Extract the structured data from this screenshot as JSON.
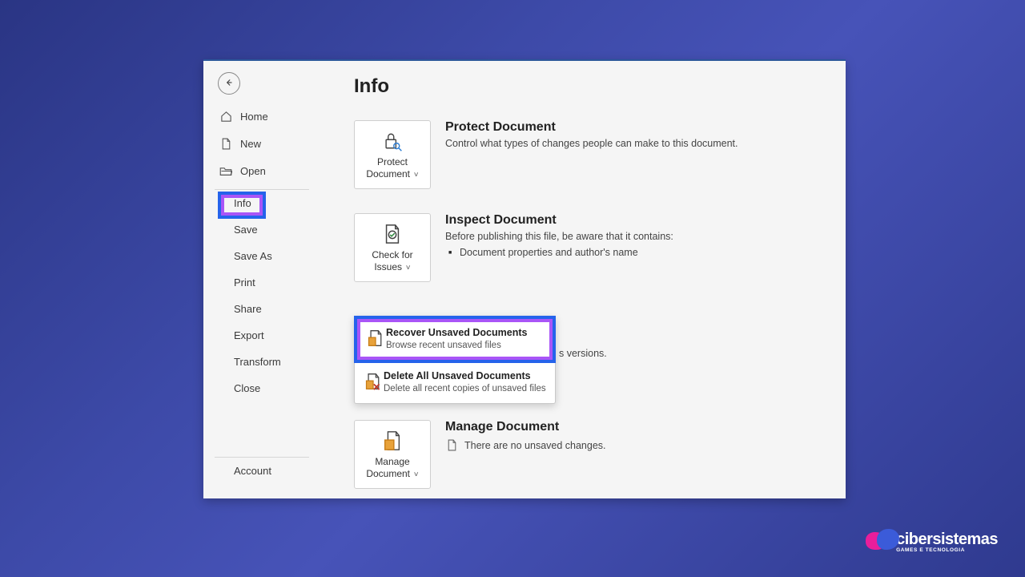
{
  "sidebar": {
    "items": {
      "home": {
        "label": "Home"
      },
      "new": {
        "label": "New"
      },
      "open": {
        "label": "Open"
      },
      "info": {
        "label": "Info"
      },
      "save": {
        "label": "Save"
      },
      "saveas": {
        "label": "Save As"
      },
      "print": {
        "label": "Print"
      },
      "share": {
        "label": "Share"
      },
      "export": {
        "label": "Export"
      },
      "transform": {
        "label": "Transform"
      },
      "close": {
        "label": "Close"
      },
      "account": {
        "label": "Account"
      }
    }
  },
  "page": {
    "title": "Info"
  },
  "sections": {
    "protect": {
      "card_label": "Protect Document",
      "title": "Protect Document",
      "desc": "Control what types of changes people can make to this document."
    },
    "inspect": {
      "card_label": "Check for Issues",
      "title": "Inspect Document",
      "desc": "Before publishing this file, be aware that it contains:",
      "bullet1": "Document properties and author's name"
    },
    "manage": {
      "card_label": "Manage Document",
      "title": "Manage Document",
      "status": "There are no unsaved changes."
    },
    "versions_fragment": "s versions."
  },
  "menu": {
    "recover": {
      "title": "Recover Unsaved Documents",
      "sub": "Browse recent unsaved files"
    },
    "delete": {
      "title": "Delete All Unsaved Documents",
      "sub": "Delete all recent copies of unsaved files"
    }
  },
  "brand": {
    "name": "cibersistemas",
    "tag": "GAMES E TECNOLOGIA"
  }
}
